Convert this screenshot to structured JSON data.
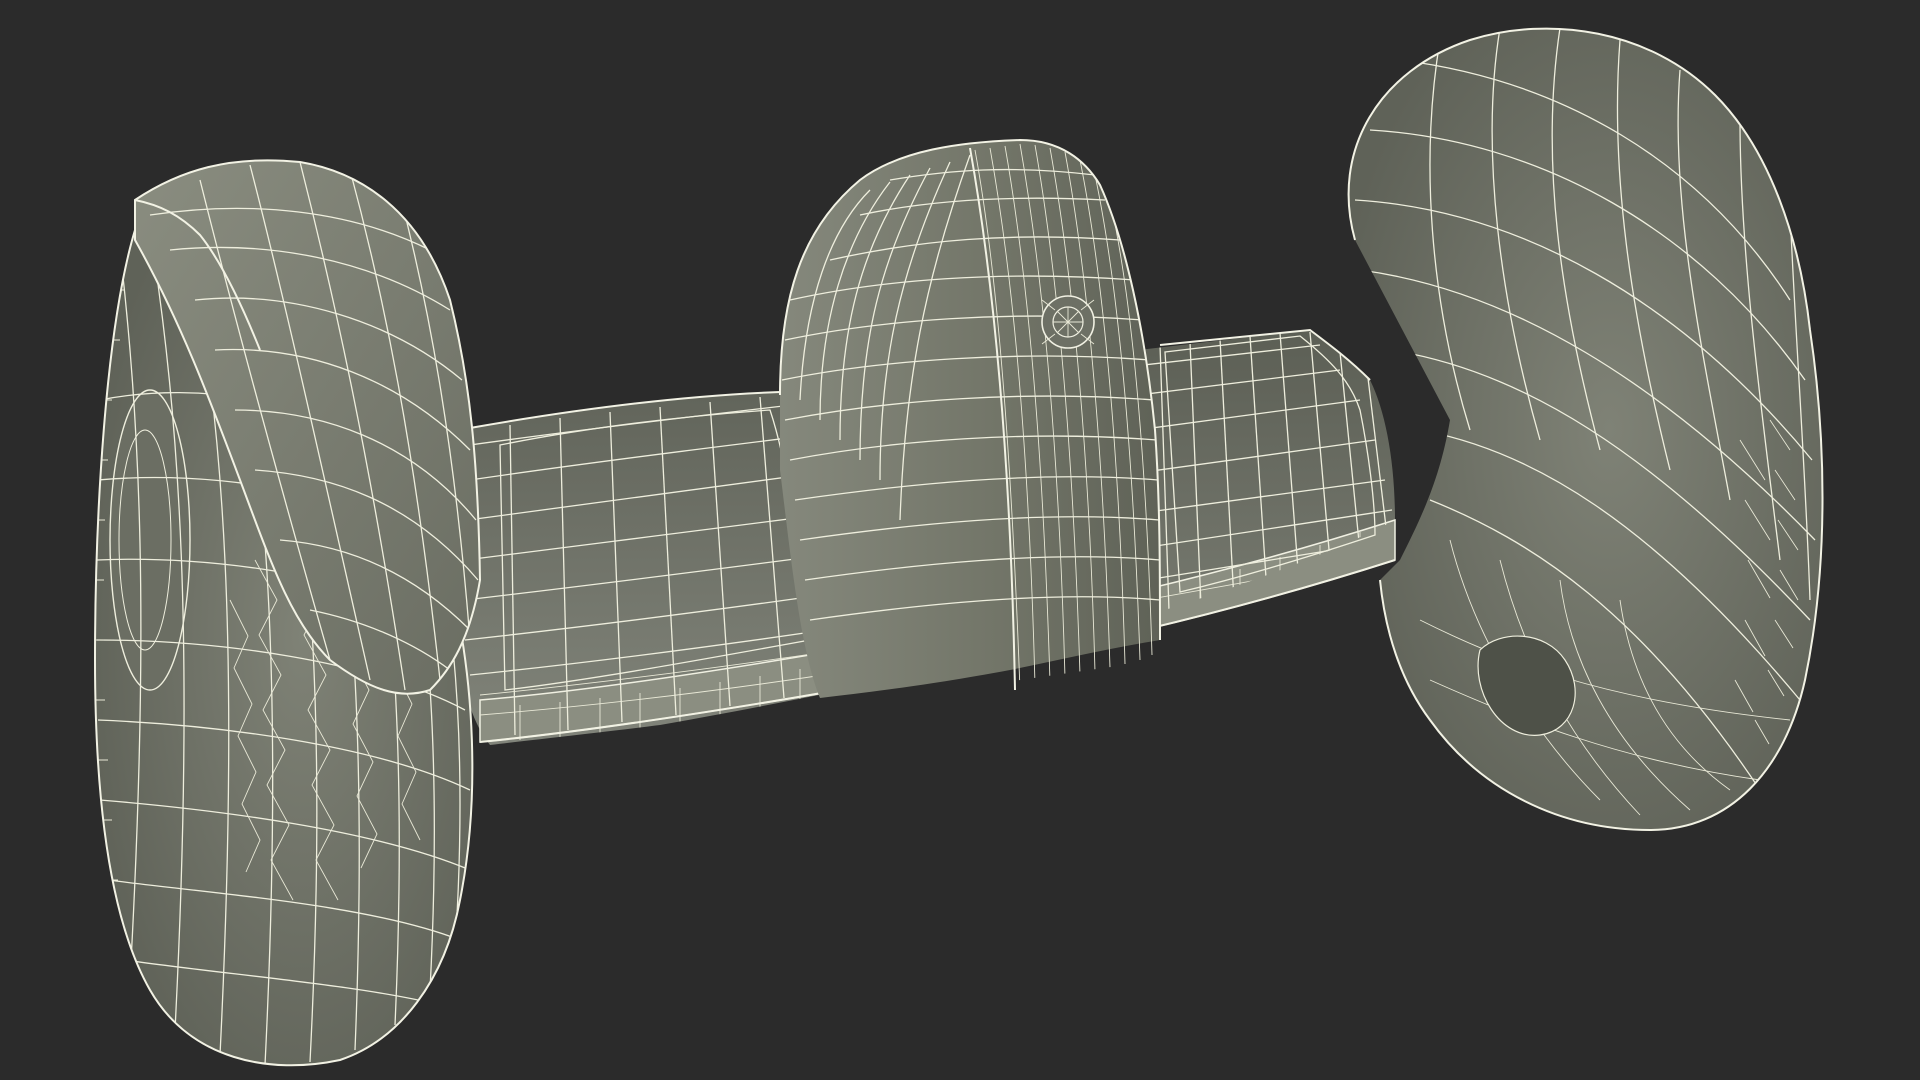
{
  "scene": {
    "subject": "self-balancing-scooter-wireframe",
    "render_style": "wireframe-over-shaded",
    "colors": {
      "background": "#2b2b2b",
      "surface": "#7c7f72",
      "surface_dark": "#5d6056",
      "surface_light": "#8d9083",
      "wire": "#eeeedd"
    }
  }
}
